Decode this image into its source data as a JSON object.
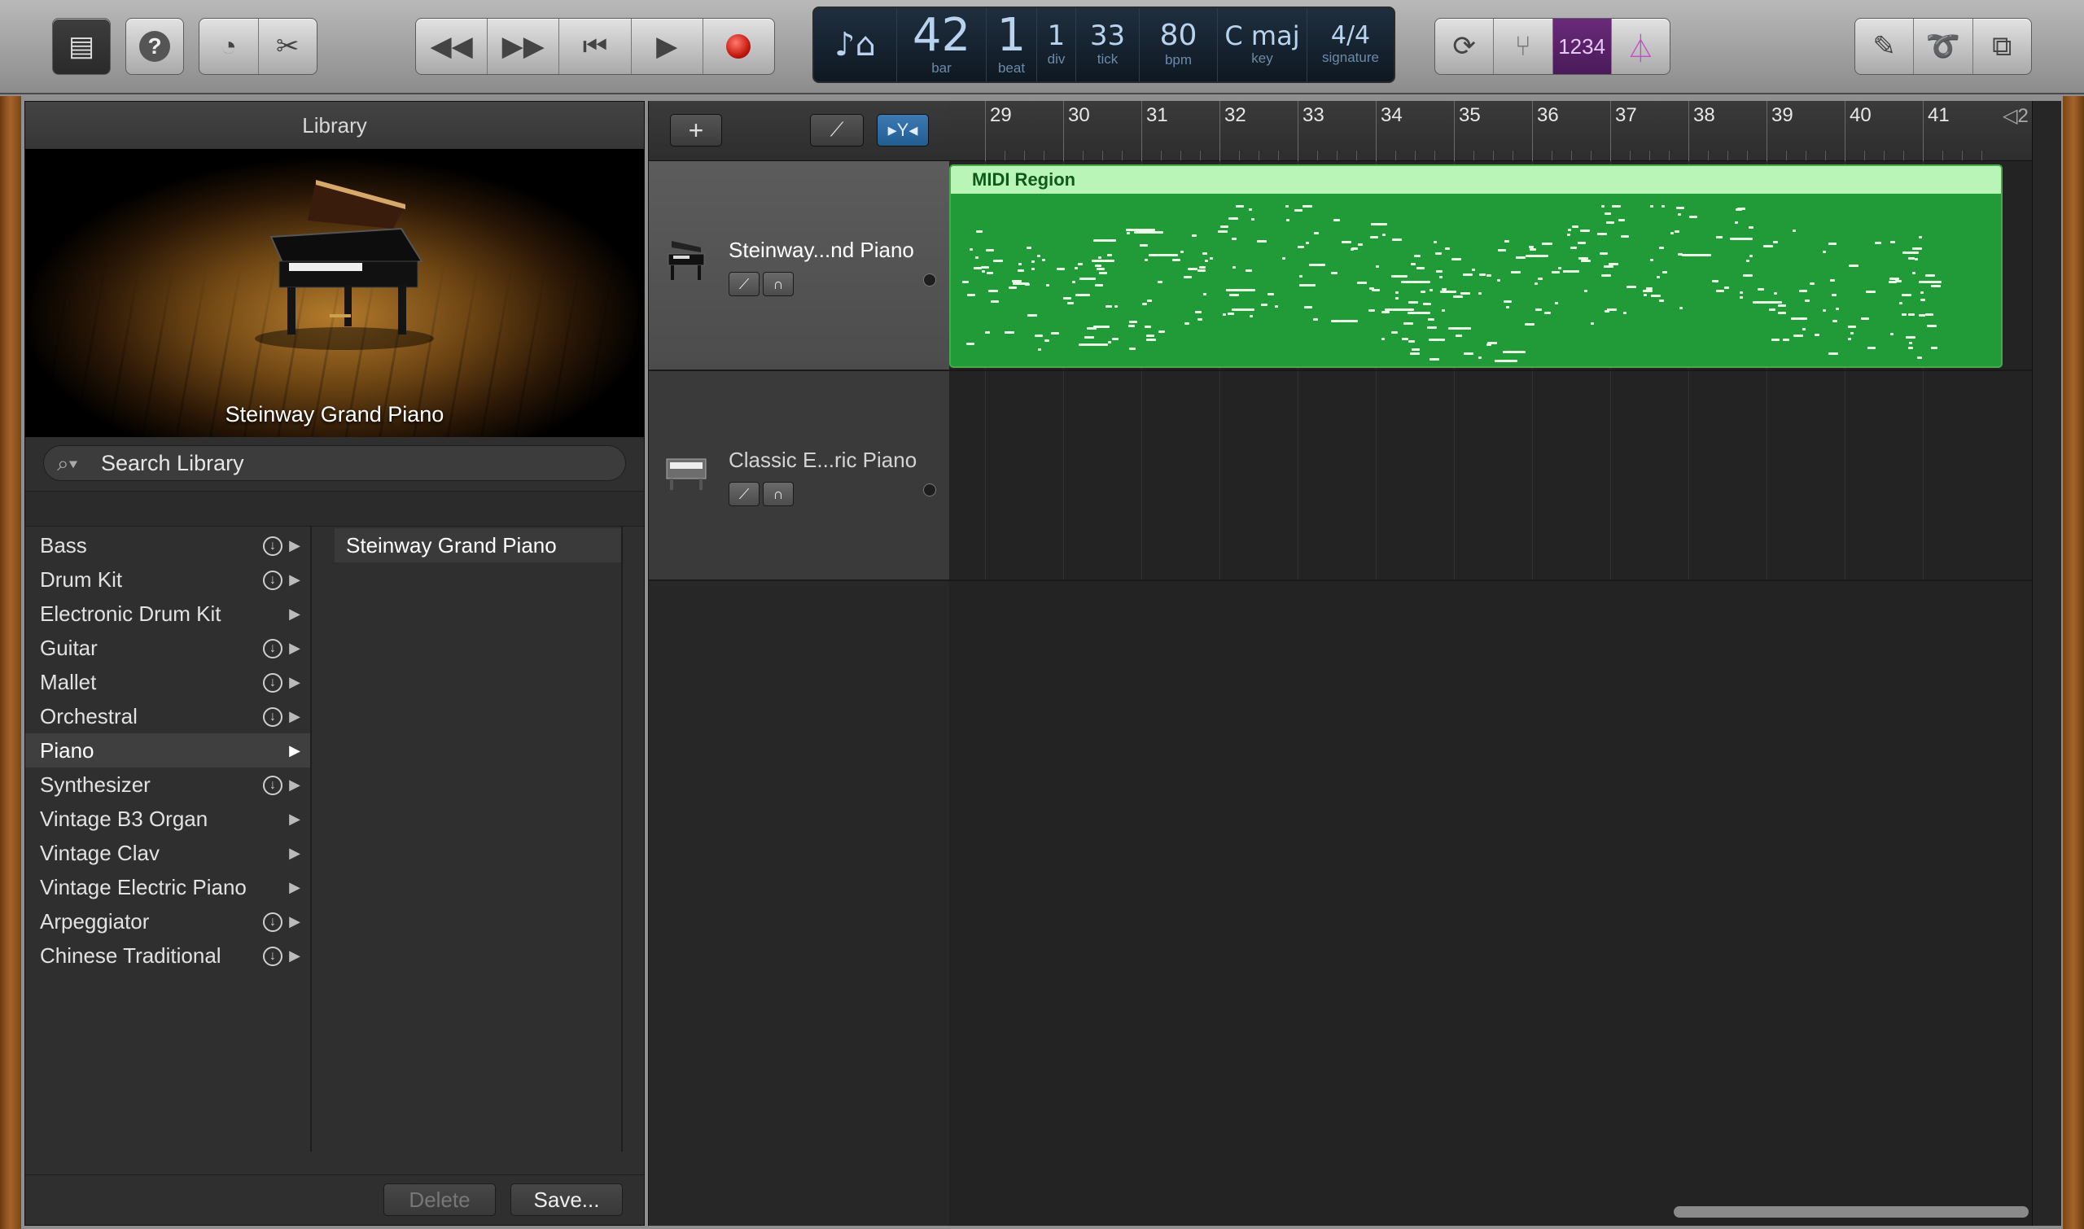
{
  "toolbar": {
    "lcd": {
      "bar_value": "42",
      "bar_label": "bar",
      "beat_value": "1",
      "beat_label": "beat",
      "div_value": "1",
      "div_label": "div",
      "tick_value": "33",
      "tick_label": "tick",
      "bpm_value": "80",
      "bpm_label": "bpm",
      "key_value": "C maj",
      "key_label": "key",
      "signature_value": "4/4",
      "signature_label": "signature"
    },
    "count_in_label": "1234"
  },
  "library": {
    "title": "Library",
    "patch_caption": "Steinway Grand Piano",
    "search_placeholder": "Search Library",
    "categories": [
      {
        "label": "Bass",
        "download": true
      },
      {
        "label": "Drum Kit",
        "download": true
      },
      {
        "label": "Electronic Drum Kit",
        "download": false
      },
      {
        "label": "Guitar",
        "download": true
      },
      {
        "label": "Mallet",
        "download": true
      },
      {
        "label": "Orchestral",
        "download": true
      },
      {
        "label": "Piano",
        "download": false,
        "selected": true
      },
      {
        "label": "Synthesizer",
        "download": true
      },
      {
        "label": "Vintage B3 Organ",
        "download": false
      },
      {
        "label": "Vintage Clav",
        "download": false
      },
      {
        "label": "Vintage Electric Piano",
        "download": false
      },
      {
        "label": "Arpeggiator",
        "download": true
      },
      {
        "label": "Chinese Traditional",
        "download": true
      }
    ],
    "patches": [
      "Steinway Grand Piano"
    ],
    "delete_label": "Delete",
    "save_label": "Save..."
  },
  "tracks": [
    {
      "name": "Steinway...nd Piano",
      "selected": true
    },
    {
      "name": "Classic E...ric Piano",
      "selected": false
    }
  ],
  "ruler": {
    "bars": [
      "29",
      "30",
      "31",
      "32",
      "33",
      "34",
      "35",
      "36",
      "37",
      "38",
      "39",
      "40",
      "41"
    ],
    "end_marker": "2"
  },
  "region": {
    "name": "MIDI Region",
    "color": "#219a38",
    "header_color": "#b9f5b7"
  },
  "colors": {
    "accent_blue": "#215c92",
    "count_in_purple": "#4a1a58",
    "record_red": "#c0130a"
  }
}
